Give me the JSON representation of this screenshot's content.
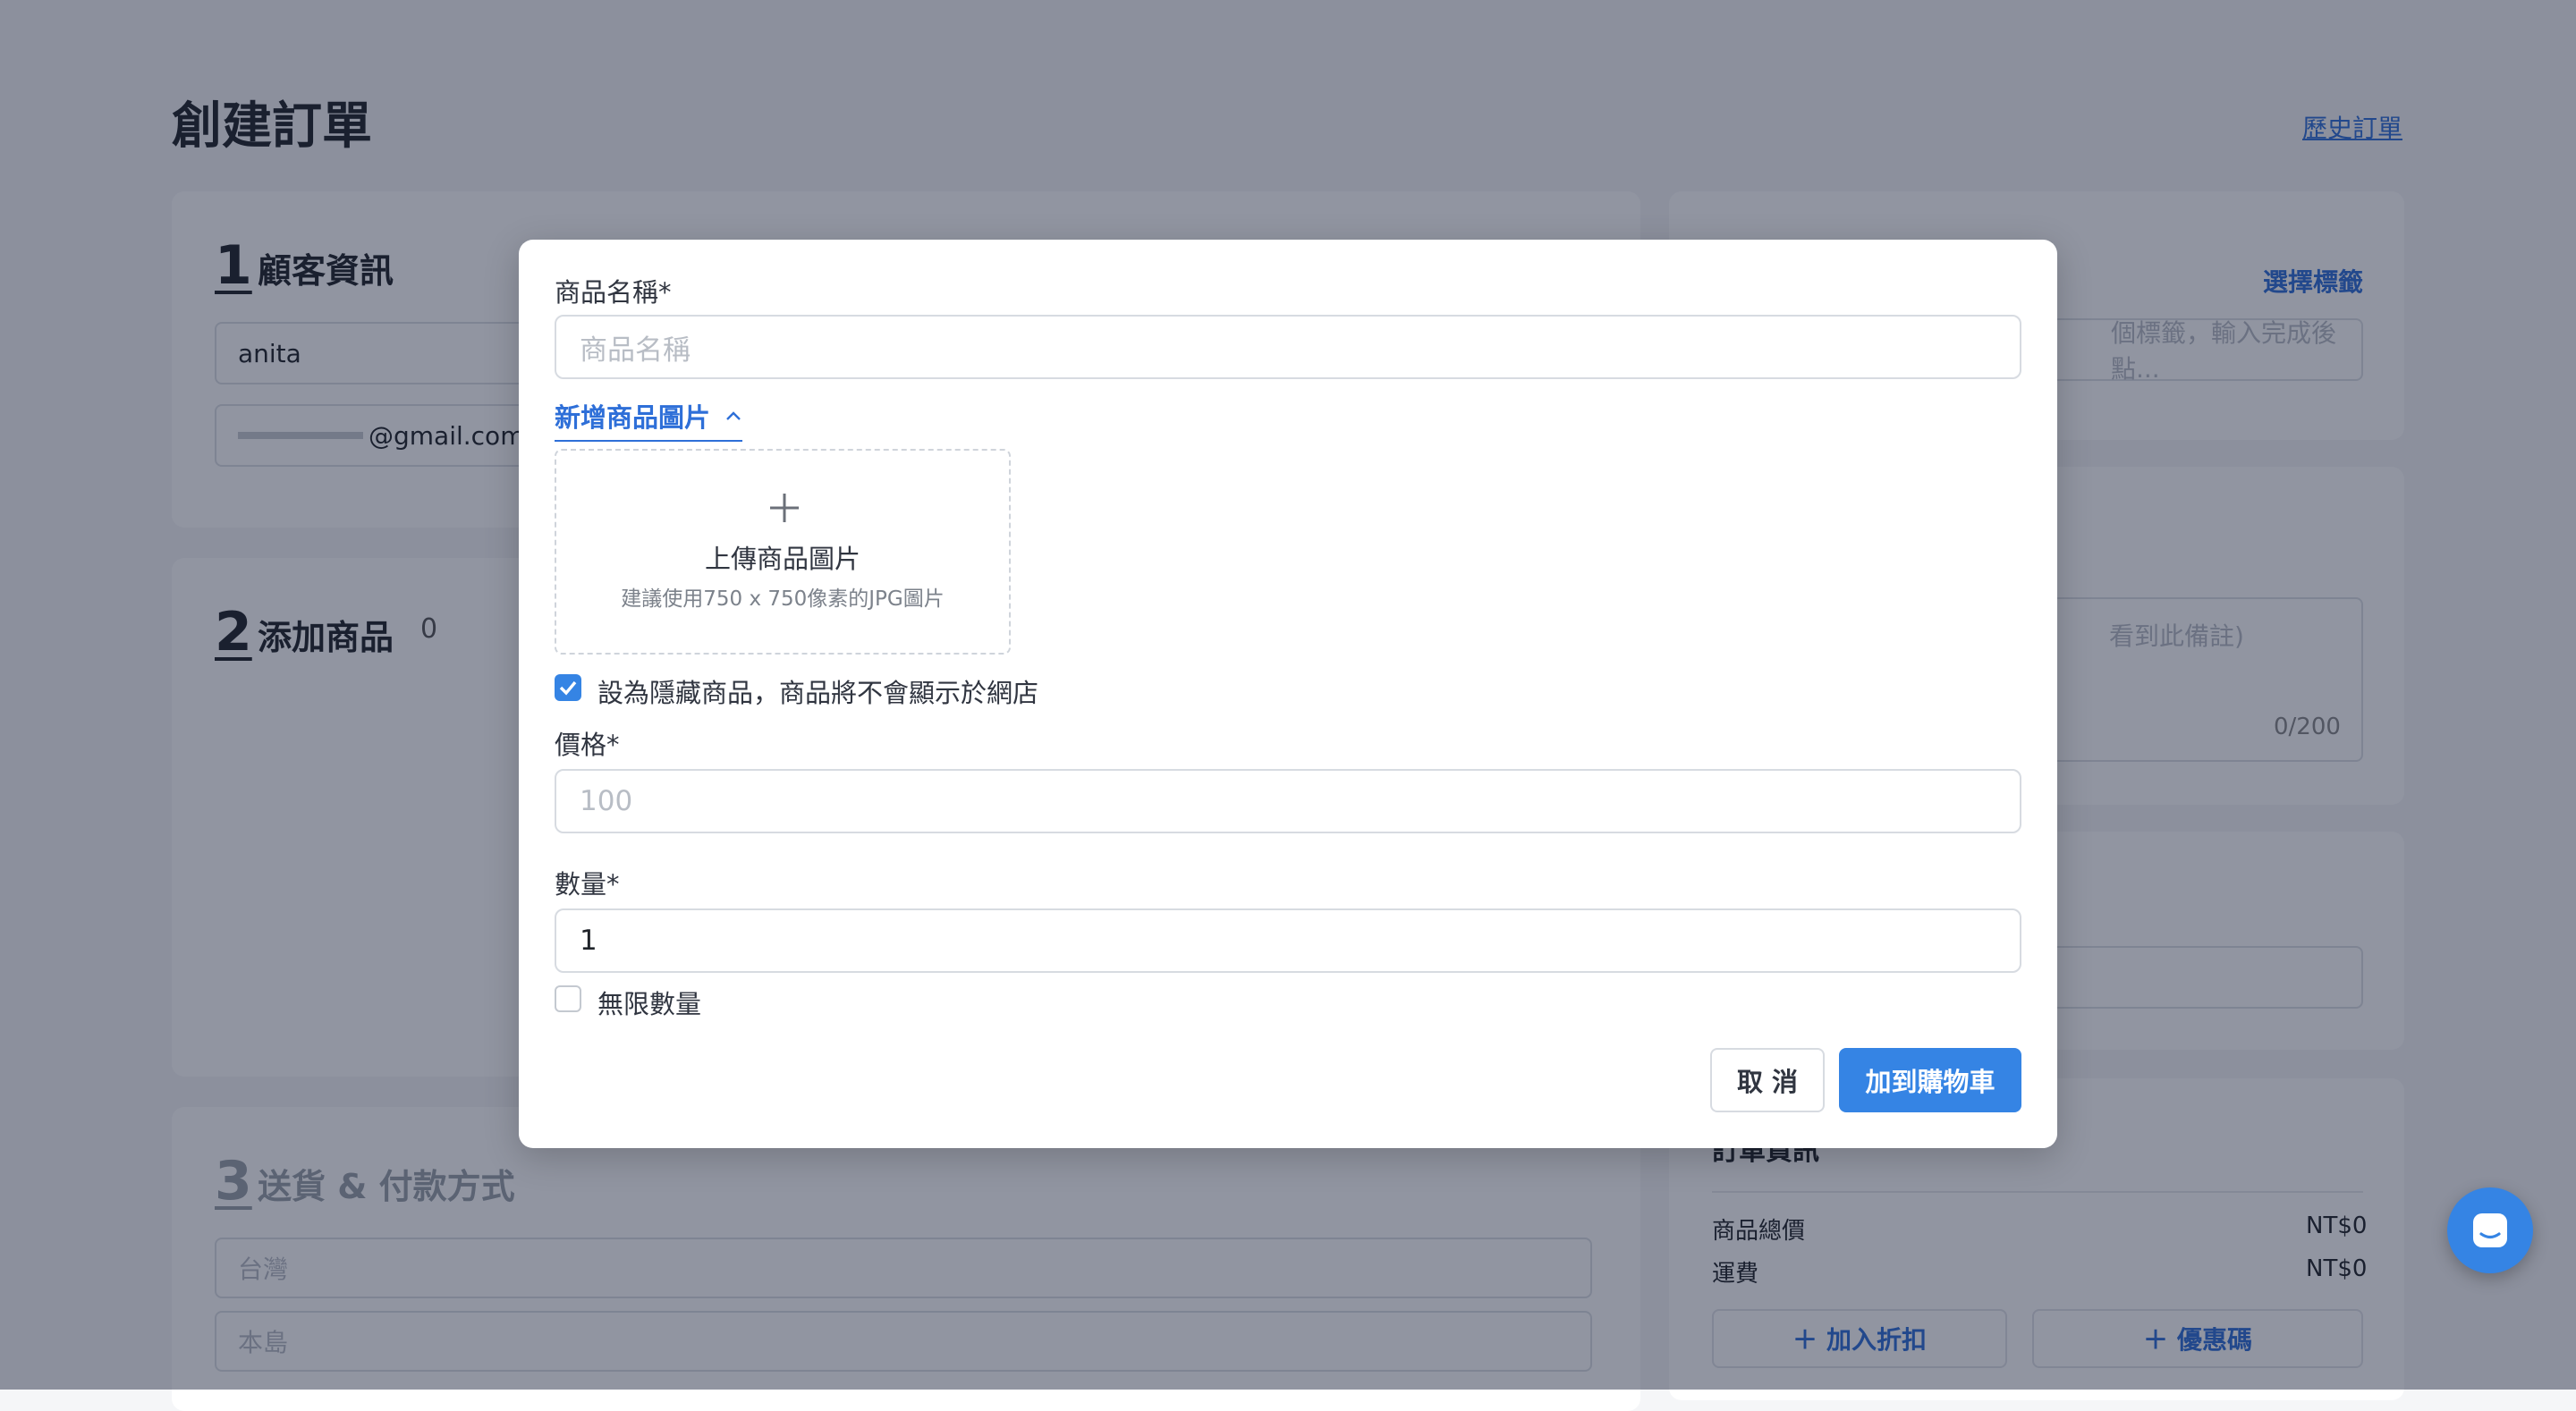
{
  "page": {
    "title": "創建訂單",
    "history_link": "歷史訂單"
  },
  "customer": {
    "num": "1",
    "title": "顧客資訊",
    "name_value": "anita",
    "email_value": "@gmail.com"
  },
  "products": {
    "num": "2",
    "title": "添加商品",
    "count": "0"
  },
  "shipping": {
    "num": "3",
    "title": "送貨 & 付款方式",
    "country": "台灣",
    "region": "本島"
  },
  "tags": {
    "select_label": "選擇標籤",
    "placeholder": "個標籤，輸入完成後點..."
  },
  "note": {
    "placeholder": "看到此備註)",
    "counter": "0/200"
  },
  "order_info": {
    "title": "訂單資訊",
    "subtotal_label": "商品總價",
    "subtotal_value": "NT$0",
    "shipping_label": "運費",
    "shipping_value": "NT$0",
    "discount_button": "加入折扣",
    "coupon_button": "優惠碼"
  },
  "modal": {
    "name_label": "商品名稱",
    "name_placeholder": "商品名稱",
    "add_image_toggle": "新增商品圖片",
    "upload_title": "上傳商品圖片",
    "upload_hint": "建議使用750 x 750像素的JPG圖片",
    "hidden_checkbox_label": "設為隱藏商品，商品將不會顯示於網店",
    "hidden_checked": true,
    "price_label": "價格",
    "price_placeholder": "100",
    "qty_label": "數量",
    "qty_value": "1",
    "unlimited_label": "無限數量",
    "unlimited_checked": false,
    "required_mark": "*",
    "cancel_button": "取 消",
    "submit_button": "加到購物車"
  },
  "colors": {
    "primary": "#3584e4",
    "link": "#2e6fd8",
    "overlay": "rgba(22,30,55,0.47)"
  }
}
